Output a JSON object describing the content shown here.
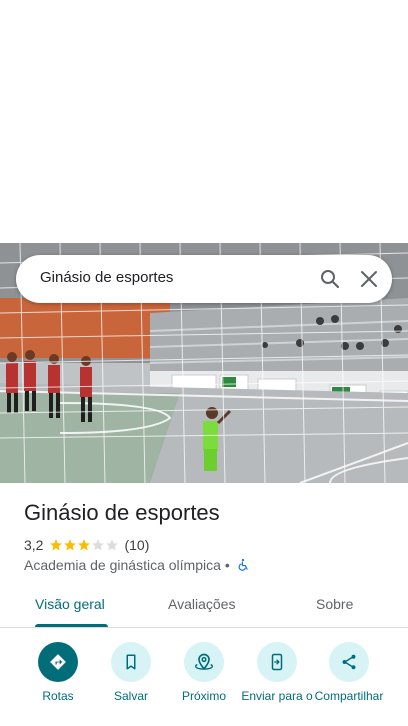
{
  "search": {
    "query": "Ginásio de esportes"
  },
  "place": {
    "title": "Ginásio de esportes",
    "rating": "3,2",
    "stars_filled": 3,
    "stars_total": 5,
    "review_count": "(10)",
    "category": "Academia de ginástica olímpica",
    "separator": "•"
  },
  "tabs": [
    {
      "label": "Visão geral",
      "active": true
    },
    {
      "label": "Avaliações",
      "active": false
    },
    {
      "label": "Sobre",
      "active": false
    }
  ],
  "actions": [
    {
      "label": "Rotas",
      "icon": "directions-icon"
    },
    {
      "label": "Salvar",
      "icon": "bookmark-icon"
    },
    {
      "label": "Próximo",
      "icon": "nearby-icon"
    },
    {
      "label": "Enviar para o",
      "icon": "send-to-phone-icon"
    },
    {
      "label": "Compartilhar",
      "icon": "share-icon"
    }
  ],
  "colors": {
    "accent": "#016d78",
    "action_bg": "#d7f3f6",
    "star": "#fbbc04"
  }
}
